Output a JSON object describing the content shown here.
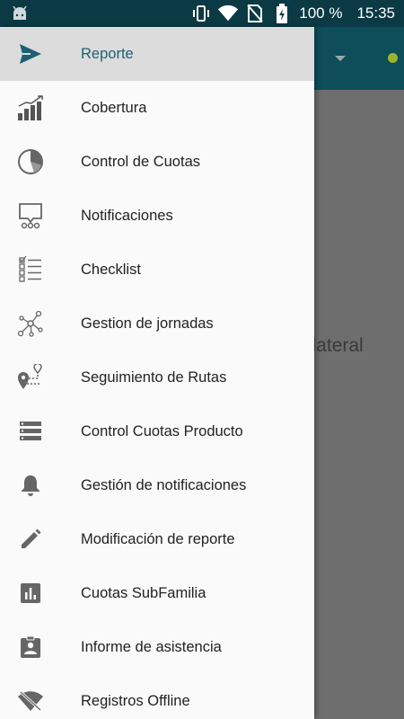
{
  "status_bar": {
    "battery_percent": "100 %",
    "time": "15:35",
    "icons": [
      "android-icon",
      "vibrate-icon",
      "wifi-icon",
      "no-sim-icon",
      "battery-charging-icon"
    ]
  },
  "background": {
    "hint_text": "ú lateral"
  },
  "drawer": {
    "items": [
      {
        "label": "Reporte",
        "icon": "send-icon",
        "selected": true
      },
      {
        "label": "Cobertura",
        "icon": "bar-chart-trend-icon"
      },
      {
        "label": "Control de Cuotas",
        "icon": "pie-chart-icon"
      },
      {
        "label": "Notificaciones",
        "icon": "presentation-icon"
      },
      {
        "label": "Checklist",
        "icon": "checklist-icon"
      },
      {
        "label": "Gestion de jornadas",
        "icon": "network-icon"
      },
      {
        "label": "Seguimiento de Rutas",
        "icon": "route-icon"
      },
      {
        "label": "Control Cuotas Producto",
        "icon": "list-icon"
      },
      {
        "label": "Gestión de notificaciones",
        "icon": "bell-icon"
      },
      {
        "label": "Modificación de reporte",
        "icon": "pencil-icon"
      },
      {
        "label": "Cuotas SubFamilia",
        "icon": "analytics-icon"
      },
      {
        "label": "Informe de asistencia",
        "icon": "badge-icon"
      },
      {
        "label": "Registros Offline",
        "icon": "wifi-off-icon"
      }
    ]
  }
}
